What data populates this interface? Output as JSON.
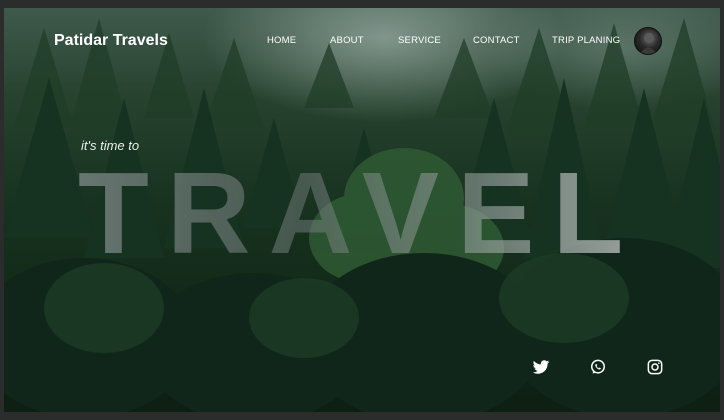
{
  "brand": {
    "name": "Patidar Travels"
  },
  "nav": {
    "items": [
      {
        "label": "HOME"
      },
      {
        "label": "ABOUT"
      },
      {
        "label": "SERVICE"
      },
      {
        "label": "CONTACT"
      },
      {
        "label": "TRIP PLANING"
      }
    ]
  },
  "hero": {
    "tagline": "it's time to",
    "headline": "TRAVEL"
  },
  "social": {
    "icons": [
      "twitter-icon",
      "whatsapp-icon",
      "instagram-icon"
    ]
  },
  "colors": {
    "text": "#ffffff",
    "forest_dark": "#0d1f12",
    "forest_mid": "#193421"
  }
}
